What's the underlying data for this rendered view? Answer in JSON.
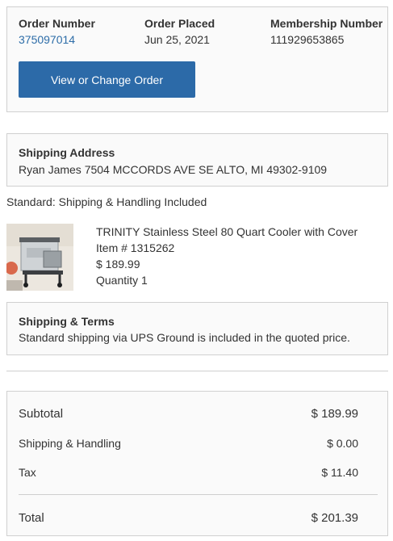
{
  "order": {
    "number_label": "Order Number",
    "number_value": "375097014",
    "placed_label": "Order Placed",
    "placed_value": "Jun 25, 2021",
    "membership_label": "Membership Number",
    "membership_value": "111929653865",
    "button_label": "View or Change Order"
  },
  "shipping_address": {
    "label": "Shipping Address",
    "value": "Ryan James  7504 MCCORDS AVE SE  ALTO, MI 49302-9109"
  },
  "shipping_method": "Standard: Shipping & Handling Included",
  "product": {
    "title": "TRINITY Stainless Steel 80 Quart Cooler with Cover",
    "item_number": "Item # 1315262",
    "price": "$ 189.99",
    "quantity": "Quantity 1",
    "image_icon": "cooler-product-image"
  },
  "shipping_terms": {
    "label": "Shipping & Terms",
    "text": "Standard shipping via UPS Ground is included in the quoted price."
  },
  "summary": {
    "subtotal_label": "Subtotal",
    "subtotal_value": "$ 189.99",
    "shipping_label": "Shipping & Handling",
    "shipping_value": "$ 0.00",
    "tax_label": "Tax",
    "tax_value": "$ 11.40",
    "total_label": "Total",
    "total_value": "$ 201.39"
  },
  "colors": {
    "accent": "#2c6aa8",
    "link": "#2d6da8",
    "border": "#d0d0d0"
  }
}
